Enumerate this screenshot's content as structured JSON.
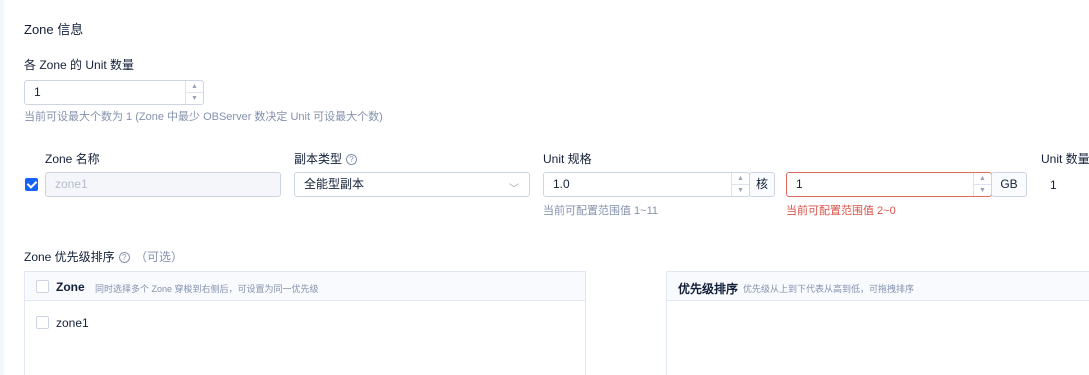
{
  "section_title": "Zone 信息",
  "unit_count": {
    "label": "各 Zone 的 Unit 数量",
    "value": "1",
    "hint": "当前可设最大个数为 1 (Zone 中最少 OBServer 数决定 Unit 可设最大个数)"
  },
  "zone_table": {
    "headers": {
      "zone_name": "Zone 名称",
      "replica_type": "副本类型",
      "unit_spec": "Unit 规格",
      "unit_count": "Unit 数量"
    },
    "rows": [
      {
        "checked": true,
        "zone_name": "zone1",
        "replica_type": "全能型副本",
        "cpu_value": "1.0",
        "cpu_unit": "核",
        "cpu_hint": "当前可配置范围值 1~11",
        "memory_value": "1",
        "memory_unit": "GB",
        "memory_hint": "当前可配置范围值 2~0",
        "unit_count": "1"
      }
    ]
  },
  "priority": {
    "label": "Zone 优先级排序",
    "optional": "（可选）",
    "left_panel": {
      "title": "Zone",
      "desc": "同时选择多个 Zone 穿梭到右侧后，可设置为同一优先级",
      "items": [
        "zone1"
      ]
    },
    "right_panel": {
      "title": "优先级排序",
      "desc": "优先级从上到下代表从高到低，可拖拽排序"
    }
  },
  "colors": {
    "primary": "#1463ff",
    "error": "#d9534a",
    "hint": "#8592ad"
  }
}
